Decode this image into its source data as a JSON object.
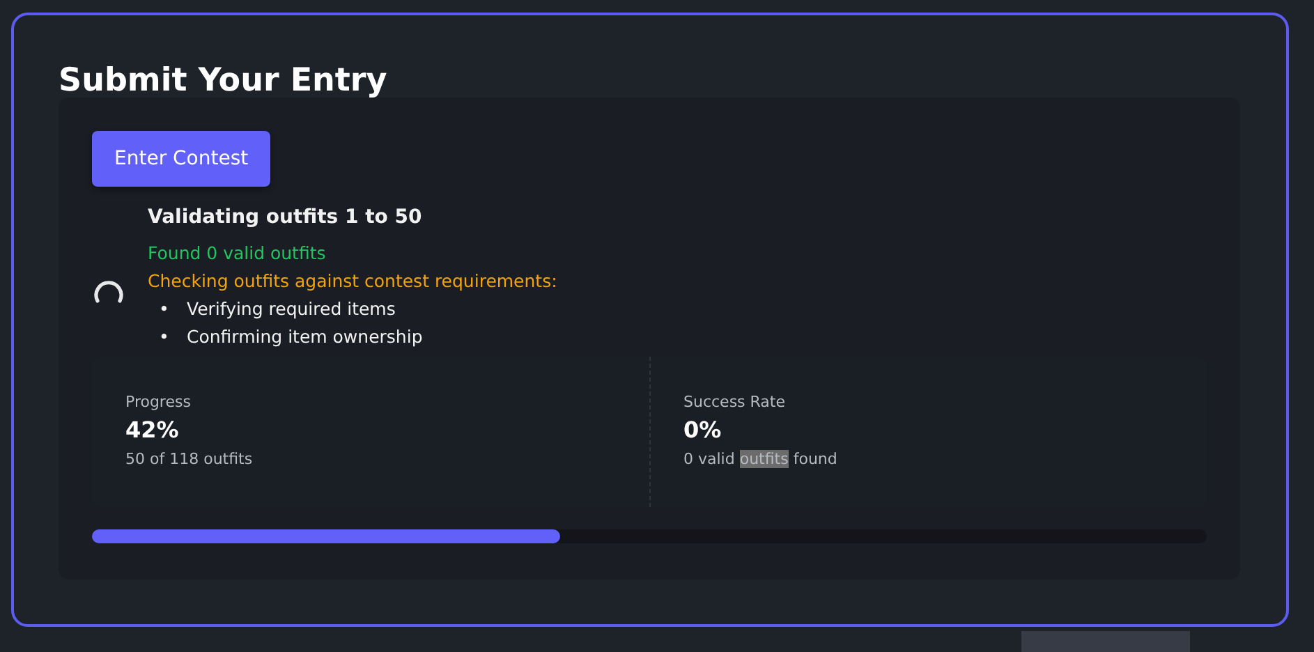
{
  "title": "Submit Your Entry",
  "button": {
    "label": "Enter Contest"
  },
  "status": {
    "heading": "Validating outfits 1 to 50",
    "found": "Found 0 valid outfits",
    "checking": "Checking outfits against contest requirements:",
    "steps": [
      {
        "bullet": "•",
        "text": "Verifying required items"
      },
      {
        "bullet": "•",
        "text": "Confirming item ownership"
      }
    ]
  },
  "stats": [
    {
      "label": "Progress",
      "value": "42%",
      "detail": [
        {
          "text": "50 of 118 outfits",
          "selected": false
        }
      ]
    },
    {
      "label": "Success Rate",
      "value": "0%",
      "detail": [
        {
          "text": "0 valid ",
          "selected": false
        },
        {
          "text": "outfits",
          "selected": true
        },
        {
          "text": " found",
          "selected": false
        }
      ]
    }
  ],
  "progress": {
    "level": 0.42
  }
}
